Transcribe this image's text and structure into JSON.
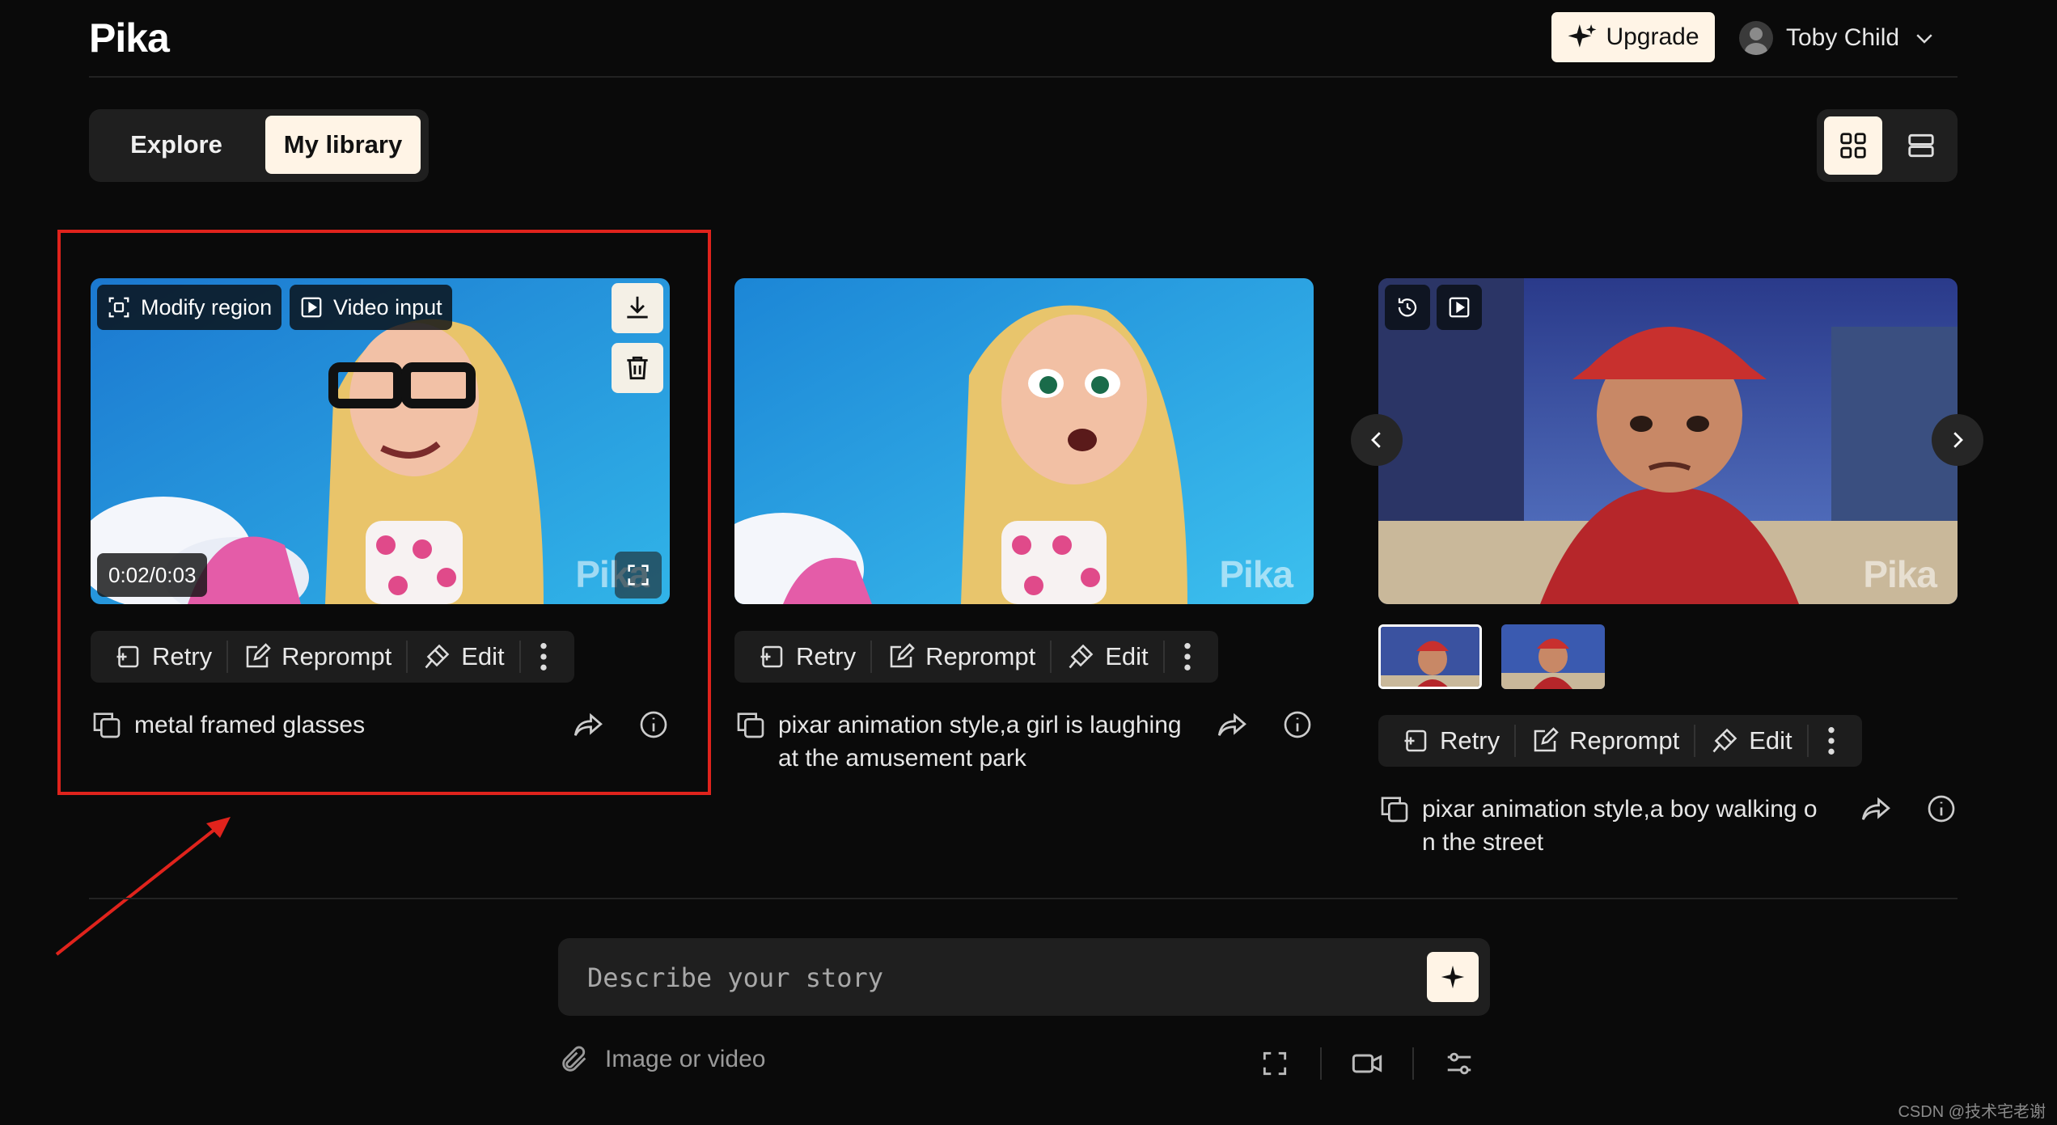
{
  "app": {
    "logo": "Pika"
  },
  "header": {
    "upgrade_label": "Upgrade",
    "user_name": "Toby Child"
  },
  "tabs": [
    {
      "label": "Explore",
      "active": false
    },
    {
      "label": "My library",
      "active": true
    }
  ],
  "view_toggle": {
    "selected": "grid"
  },
  "cards": [
    {
      "prompt": "metal framed glasses",
      "overlay": {
        "modify_region": "Modify region",
        "video_input": "Video input",
        "time": "0:02/0:03",
        "watermark": "Pika"
      },
      "actions": {
        "retry": "Retry",
        "reprompt": "Reprompt",
        "edit": "Edit"
      }
    },
    {
      "prompt_line1": "pixar animation style,a girl is laughing",
      "prompt_line2": "at the amusement park",
      "overlay": {
        "watermark": "Pika"
      },
      "actions": {
        "retry": "Retry",
        "reprompt": "Reprompt",
        "edit": "Edit"
      }
    },
    {
      "prompt_line1": "pixar animation style,a boy walking o",
      "prompt_line2": "n the street",
      "overlay": {
        "watermark": "Pika"
      },
      "actions": {
        "retry": "Retry",
        "reprompt": "Reprompt",
        "edit": "Edit"
      }
    }
  ],
  "composer": {
    "placeholder": "Describe your story",
    "attach_label": "Image or video"
  },
  "footer_watermark": "CSDN @技术宅老谢",
  "colors": {
    "accent": "#fff4e6",
    "background": "#0a0a0a",
    "highlight": "#e0231c"
  }
}
